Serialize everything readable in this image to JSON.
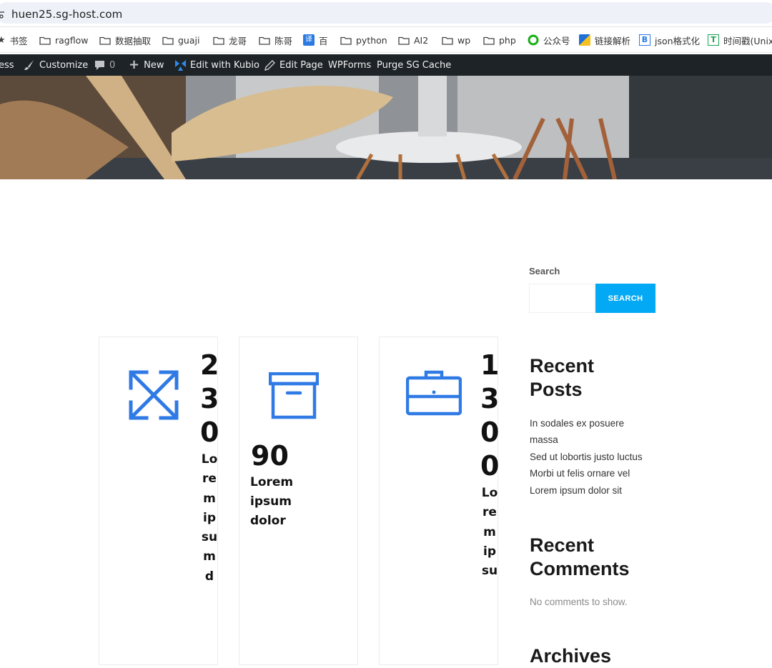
{
  "browser": {
    "url": "huen25.sg-host.com"
  },
  "bookmarks": [
    {
      "label": "书签",
      "icon": "star-icon"
    },
    {
      "label": "ragflow",
      "icon": "folder-icon"
    },
    {
      "label": "数据抽取",
      "icon": "folder-icon"
    },
    {
      "label": "guaji",
      "icon": "folder-icon"
    },
    {
      "label": "龙哥",
      "icon": "folder-icon"
    },
    {
      "label": "陈哥",
      "icon": "folder-icon"
    },
    {
      "label": "百",
      "icon": "translate-icon"
    },
    {
      "label": "python",
      "icon": "folder-icon"
    },
    {
      "label": "AI2",
      "icon": "folder-icon"
    },
    {
      "label": "wp",
      "icon": "folder-icon"
    },
    {
      "label": "php",
      "icon": "folder-icon"
    },
    {
      "label": "公众号",
      "icon": "wechat-icon"
    },
    {
      "label": "链接解析",
      "icon": "link-parse-icon"
    },
    {
      "label": "json格式化",
      "icon": "json-icon"
    },
    {
      "label": "时间戳(Unix",
      "icon": "timestamp-icon"
    }
  ],
  "adminbar": {
    "site_fragment": "ess",
    "customize": "Customize",
    "comments_count": "0",
    "new": "New",
    "edit_kubio": "Edit with Kubio",
    "edit_page": "Edit Page",
    "wpforms": "WPForms",
    "purge": "Purge SG Cache"
  },
  "sidebar": {
    "search_label": "Search",
    "search_placeholder": "",
    "search_button": "SEARCH",
    "recent_posts_heading": "Recent Posts",
    "recent_posts": [
      "In sodales ex posuere massa",
      "Sed ut lobortis justo luctus",
      "Morbi ut felis ornare vel",
      "Lorem ipsum dolor sit"
    ],
    "recent_comments_heading": "Recent Comments",
    "no_comments": "No comments to show.",
    "archives_heading": "Archives"
  },
  "counters": [
    {
      "number": "230",
      "text": "Lorem ipsum d",
      "icon": "expand-arrows-icon"
    },
    {
      "number": "90",
      "text": "Lorem ipsum dolor",
      "icon": "archive-box-icon"
    },
    {
      "number": "1300",
      "text": "Lorem ipsu",
      "icon": "briefcase-icon"
    }
  ],
  "colors": {
    "accent": "#03a9f4",
    "icon_blue": "#2f7ae5",
    "adminbar": "#1d2327"
  }
}
